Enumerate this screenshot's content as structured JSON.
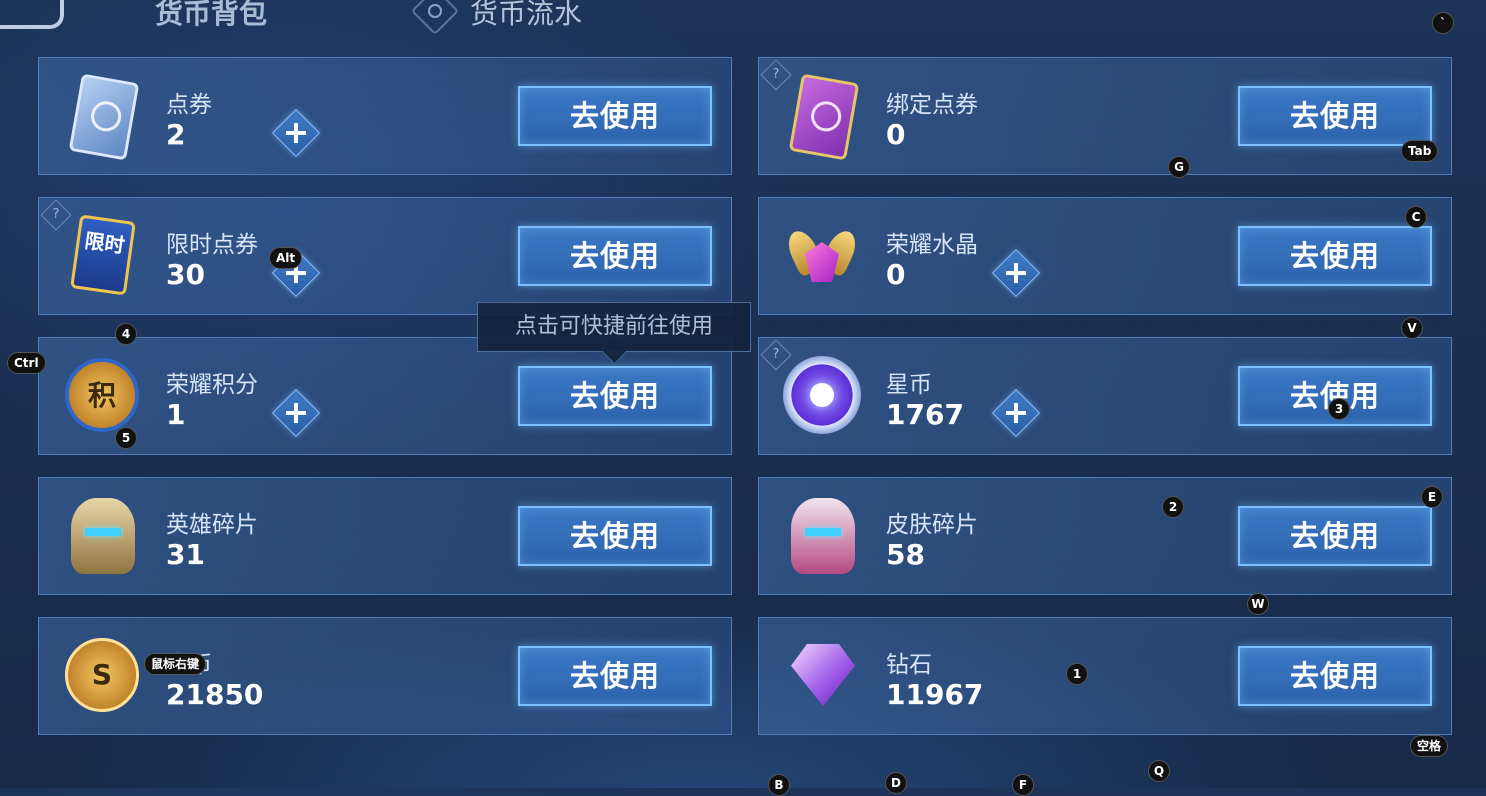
{
  "tabs": {
    "bag_label": "货币背包",
    "flow_label": "货币流水"
  },
  "currencies": [
    {
      "name": "点券",
      "amount": "2",
      "action": "去使用"
    },
    {
      "name": "绑定点券",
      "amount": "0",
      "action": "去使用"
    },
    {
      "name": "限时点券",
      "amount": "30",
      "action": "去使用",
      "icon_text": "限时"
    },
    {
      "name": "荣耀水晶",
      "amount": "0",
      "action": "去使用"
    },
    {
      "name": "荣耀积分",
      "amount": "1",
      "action": "去使用",
      "icon_text": "积"
    },
    {
      "name": "星币",
      "amount": "1767",
      "action": "去使用"
    },
    {
      "name": "英雄碎片",
      "amount": "31",
      "action": "去使用"
    },
    {
      "name": "皮肤碎片",
      "amount": "58",
      "action": "去使用"
    },
    {
      "name": "金币",
      "amount": "21850",
      "action": "去使用",
      "icon_text": "S"
    },
    {
      "name": "钻石",
      "amount": "11967",
      "action": "去使用"
    }
  ],
  "help_symbol": "?",
  "tooltip": "点击可快捷前往使用",
  "key_hints": {
    "backtick": "`",
    "tab": "Tab",
    "g": "G",
    "alt": "Alt",
    "c": "C",
    "four": "4",
    "v": "V",
    "ctrl": "Ctrl",
    "five": "5",
    "three": "3",
    "two": "2",
    "e": "E",
    "w": "W",
    "right_click": "鼠标右键",
    "one": "1",
    "space": "空格",
    "b": "B",
    "d": "D",
    "f": "F",
    "q": "Q"
  },
  "colors": {
    "background": "#1b2f52",
    "card": "#3d6aa5",
    "button": "#3c78c5",
    "button_border": "#7dc0ff"
  }
}
